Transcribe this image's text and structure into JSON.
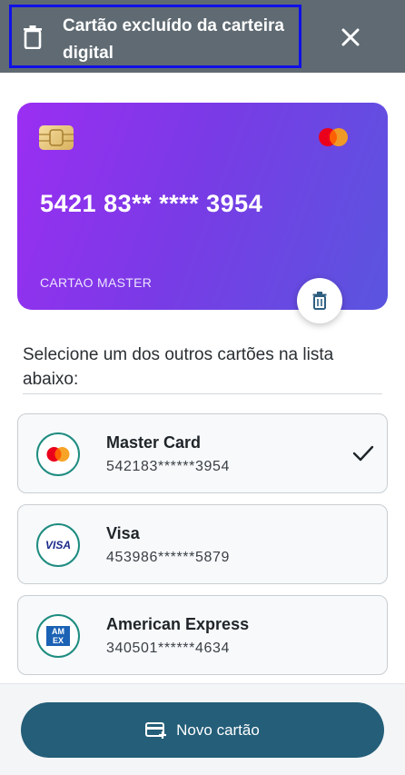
{
  "toast": {
    "message": "Cartão excluído da carteira digital",
    "icon": "trash-icon",
    "close_icon": "close-icon"
  },
  "card": {
    "number": "5421 83** **** 3954",
    "holder": "CARTAO MASTER",
    "brand_icon": "mastercard-icon",
    "chip_icon": "chip-icon",
    "delete_icon": "trash-icon"
  },
  "instruction": "Selecione um dos outros cartões na lista abaixo:",
  "cards_list": [
    {
      "name": "Master Card",
      "number": "542183******3954",
      "brand": "mastercard",
      "selected": true
    },
    {
      "name": "Visa",
      "number": "453986******5879",
      "brand": "visa",
      "brand_label": "VISA",
      "selected": false
    },
    {
      "name": "American Express",
      "number": "340501******4634",
      "brand": "amex",
      "brand_label": "AMEX",
      "selected": false
    }
  ],
  "footer": {
    "new_card_label": "Novo cartão",
    "icon": "add-card-icon"
  },
  "colors": {
    "toast_bg": "#5f6a72",
    "highlight_border": "#1010e8",
    "card_gradient_start": "#9b2ef2",
    "card_gradient_end": "#5a55df",
    "brand_ring": "#1e8c80",
    "button_bg": "#245e78"
  }
}
